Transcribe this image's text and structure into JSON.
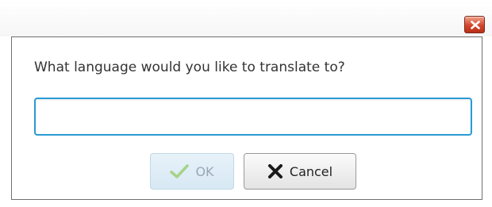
{
  "dialog": {
    "prompt": "What language would you like to translate to?",
    "input_value": "",
    "input_placeholder": "",
    "ok_label": "OK",
    "cancel_label": "Cancel",
    "ok_enabled": false
  },
  "icons": {
    "close": "close-icon",
    "ok": "checkmark-icon",
    "cancel": "x-icon"
  },
  "colors": {
    "close_button": "#d2472c",
    "input_focus_border": "#2a9bd4",
    "ok_checkmark": "#a6d38a"
  }
}
